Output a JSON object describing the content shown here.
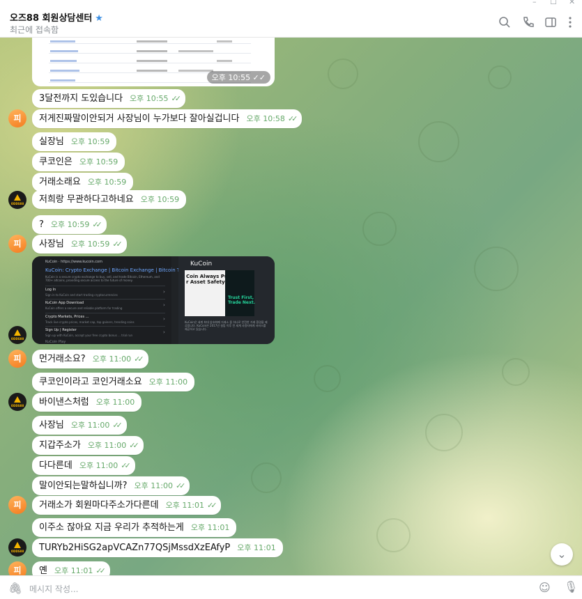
{
  "window": {
    "minimize": "–",
    "maximize": "☐",
    "close": "✕"
  },
  "header": {
    "title": "오즈88 회원상담센터",
    "status": "최근에 접속함"
  },
  "top_image": {
    "time": "오후 10:55"
  },
  "messages": [
    {
      "text": "3달전까지 도있습니다",
      "time": "오후 10:55",
      "check": "✓✓"
    },
    {
      "text": "저게진짜말이안되거 사장님이 누가보다 잘아실겁니다",
      "time": "오후 10:58",
      "check": "✓✓"
    },
    {
      "text": "실장님",
      "time": "오후 10:59"
    },
    {
      "text": "쿠코인은",
      "time": "오후 10:59"
    },
    {
      "text": "거래소래요",
      "time": "오후 10:59"
    },
    {
      "text": "저희랑 무관하다고하네요",
      "time": "오후 10:59"
    },
    {
      "text": "?",
      "time": "오후 10:59",
      "check": "✓✓"
    },
    {
      "text": "사장님",
      "time": "오후 10:59",
      "check": "✓✓"
    },
    {
      "text": "먼거래소요?",
      "time": "오후 11:00",
      "check": "✓✓"
    },
    {
      "text": "쿠코인이라고 코인거래소요",
      "time": "오후 11:00"
    },
    {
      "text": "바이낸스처럼",
      "time": "오후 11:00"
    },
    {
      "text": "사장님",
      "time": "오후 11:00",
      "check": "✓✓"
    },
    {
      "text": "지갑주소가",
      "time": "오후 11:00",
      "check": "✓✓"
    },
    {
      "text": "다다른데",
      "time": "오후 11:00",
      "check": "✓✓"
    },
    {
      "text": "말이안되는말하십니까?",
      "time": "오후 11:00",
      "check": "✓✓"
    },
    {
      "text": "거래소가 회원마다주소가다른데",
      "time": "오후 11:01",
      "check": "✓✓"
    },
    {
      "text": "이주소 잖아요 지금 우리가 추적하는게",
      "time": "오후 11:01"
    },
    {
      "text": "TURYb2HiSG2apVCAZn77QSjMssdXzEAfyP",
      "time": "오후 11:01"
    },
    {
      "text": "옌",
      "time": "오후 11:01",
      "check": "✓✓"
    }
  ],
  "avatars": {
    "orange_initial": "피",
    "dark_label": "ODDS88"
  },
  "link_preview": {
    "site": "KuCoin · https://www.kucoin.com",
    "title": "KuCoin: Crypto Exchange | Bitcoin Exchange | Bitcoin Trading",
    "description": "KuCoin is a secure crypto exchange to buy, sell, and trade Bitcoin, Ethereum, and 700+ altcoins, providing secure access to the future of money.",
    "items": [
      {
        "title": "Log In",
        "sub": "Sign in to KuCoin and start trading cryptocurrencies"
      },
      {
        "title": "KuCoin App Download",
        "sub": "KuCoin offers a secure and reliable platform for trading"
      },
      {
        "title": "Crypto Markets, Prices ...",
        "sub": "Track live crypto prices, market cap, top gainers, trending coins"
      },
      {
        "title": "Sign Up | Register",
        "sub": "Sign up with KuCoin, accept your free crypto bonus ... trial run"
      }
    ],
    "more": "KuCoin Play",
    "card_title": "KuCoin",
    "card_headline": "Coin Always Puts\nr Asset Safety Fir",
    "card_slogan": "Trust First,\nTrade Next.",
    "card_text": "KuCoin은 세계 최대 암호화폐 거래소 중 하나로 안전한 거래 환경을 제공합니다. KuCoin은 2017년 설립 이후 전 세계 사용자에게 서비스를 제공하고 있습니다."
  },
  "input": {
    "placeholder": "메시지 작성..."
  },
  "icons": {
    "search": "search-icon",
    "phone": "phone-icon",
    "sidebar": "sidebar-toggle-icon",
    "more": "more-vertical-icon",
    "attach": "paperclip-icon",
    "emoji": "emoji-icon",
    "mic": "microphone-icon",
    "scroll": "chevron-down-icon"
  }
}
